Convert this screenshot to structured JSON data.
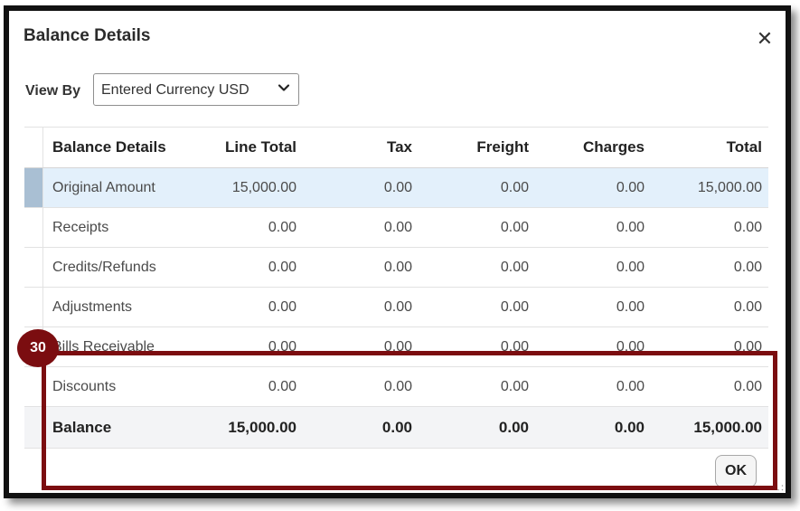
{
  "dialog": {
    "title": "Balance Details",
    "close_glyph": "✕"
  },
  "view_by": {
    "label": "View By",
    "selected": "Entered Currency USD"
  },
  "table": {
    "columns": [
      "Balance Details",
      "Line Total",
      "Tax",
      "Freight",
      "Charges",
      "Total"
    ],
    "rows": [
      [
        "Original Amount",
        "15,000.00",
        "0.00",
        "0.00",
        "0.00",
        "15,000.00"
      ],
      [
        "Receipts",
        "0.00",
        "0.00",
        "0.00",
        "0.00",
        "0.00"
      ],
      [
        "Credits/Refunds",
        "0.00",
        "0.00",
        "0.00",
        "0.00",
        "0.00"
      ],
      [
        "Adjustments",
        "0.00",
        "0.00",
        "0.00",
        "0.00",
        "0.00"
      ],
      [
        "Bills Receivable",
        "0.00",
        "0.00",
        "0.00",
        "0.00",
        "0.00"
      ],
      [
        "Discounts",
        "0.00",
        "0.00",
        "0.00",
        "0.00",
        "0.00"
      ]
    ],
    "total_row": [
      "Balance",
      "15,000.00",
      "0.00",
      "0.00",
      "0.00",
      "15,000.00"
    ]
  },
  "ok_label": "OK",
  "callout": {
    "number": "30",
    "color": "#7b0d10"
  },
  "colors": {
    "selected_row": "#e3f0fb",
    "selected_gutter": "#a9bfd3",
    "total_row": "#f3f4f6"
  }
}
